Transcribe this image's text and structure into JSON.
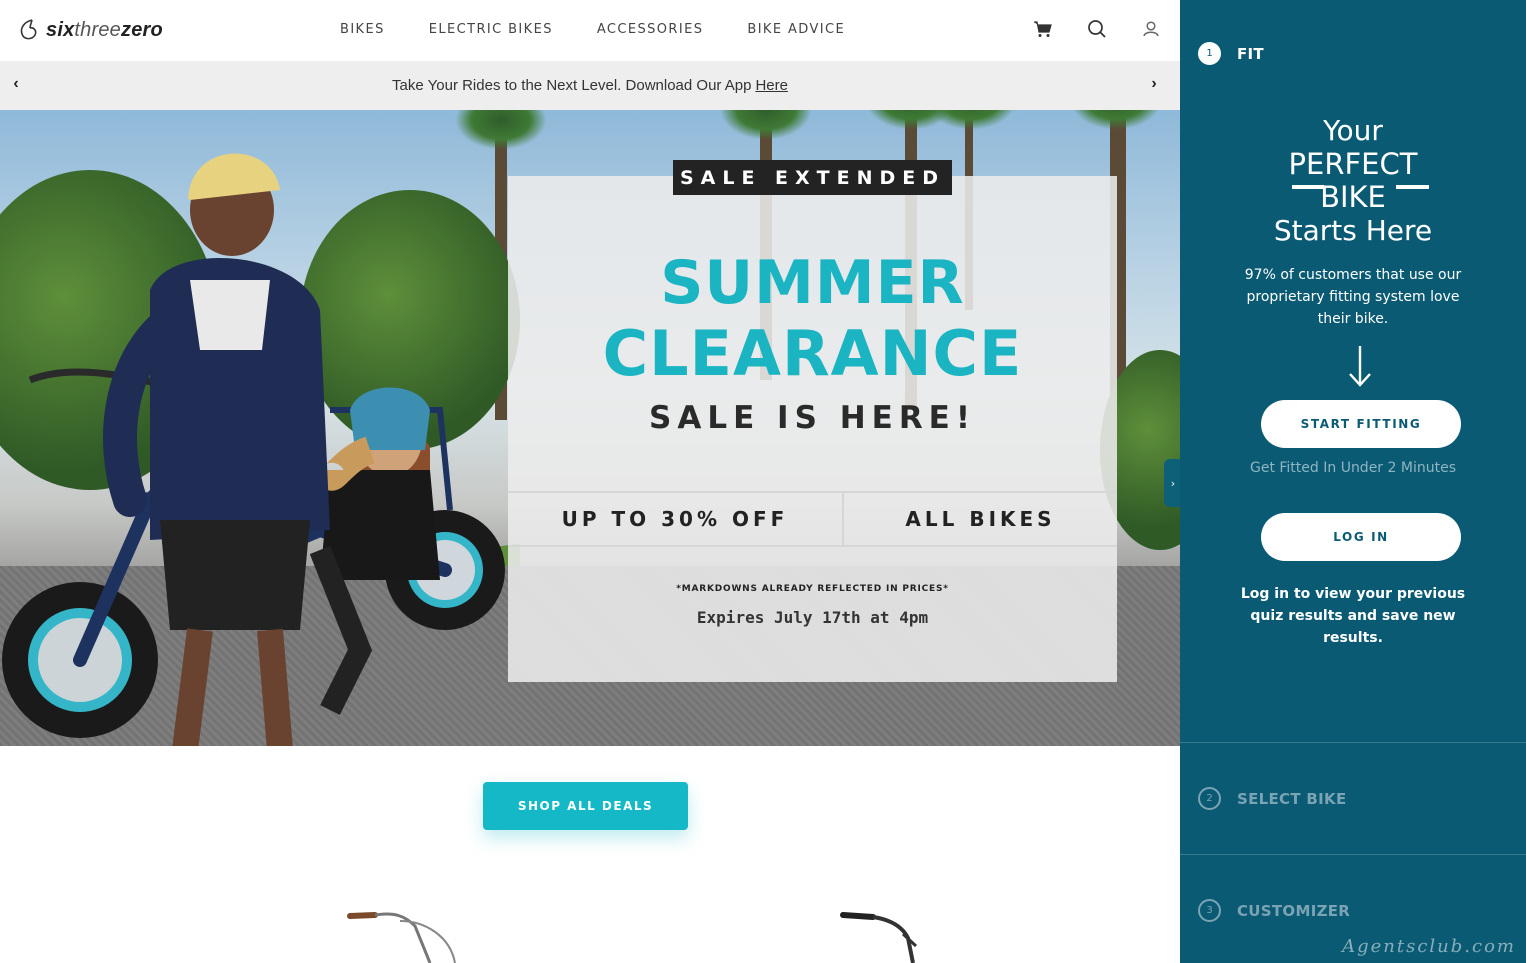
{
  "brand": {
    "name_part1": "six",
    "name_part2": "three",
    "name_part3": "zero"
  },
  "nav": {
    "items": [
      "BIKES",
      "ELECTRIC BIKES",
      "ACCESSORIES",
      "BIKE ADVICE"
    ]
  },
  "header_icons": [
    "cart-icon",
    "search-icon",
    "account-icon"
  ],
  "announcement": {
    "text": "Take Your Rides to the Next Level. Download Our App",
    "link": "Here"
  },
  "hero": {
    "badge": "SALE EXTENDED",
    "headline_1": "SUMMER",
    "headline_2": "CLEARANCE",
    "subhead": "SALE IS HERE!",
    "offer_left": "UP TO 30% OFF",
    "offer_right": "ALL BIKES",
    "note": "*MARKDOWNS ALREADY REFLECTED IN PRICES*",
    "expires": "Expires July 17th at 4pm"
  },
  "shop": {
    "button": "SHOP ALL DEALS"
  },
  "panel": {
    "steps": [
      {
        "num": "1",
        "label": "FIT"
      },
      {
        "num": "2",
        "label": "SELECT BIKE"
      },
      {
        "num": "3",
        "label": "CUSTOMIZER"
      }
    ],
    "heading_1": "Your",
    "heading_2": "PERFECT",
    "heading_3": "BIKE",
    "heading_4": "Starts Here",
    "intro": "97% of customers that use our proprietary fitting system love their bike.",
    "start_button": "START FITTING",
    "start_sub": "Get Fitted In Under 2 Minutes",
    "login_button": "LOG IN",
    "login_note": "Log in to view your previous quiz results and save new results."
  },
  "watermark": "Agentsclub.com",
  "colors": {
    "accent": "#14b8c6",
    "panel": "#0b5a74",
    "headline": "#1bb4c2"
  }
}
